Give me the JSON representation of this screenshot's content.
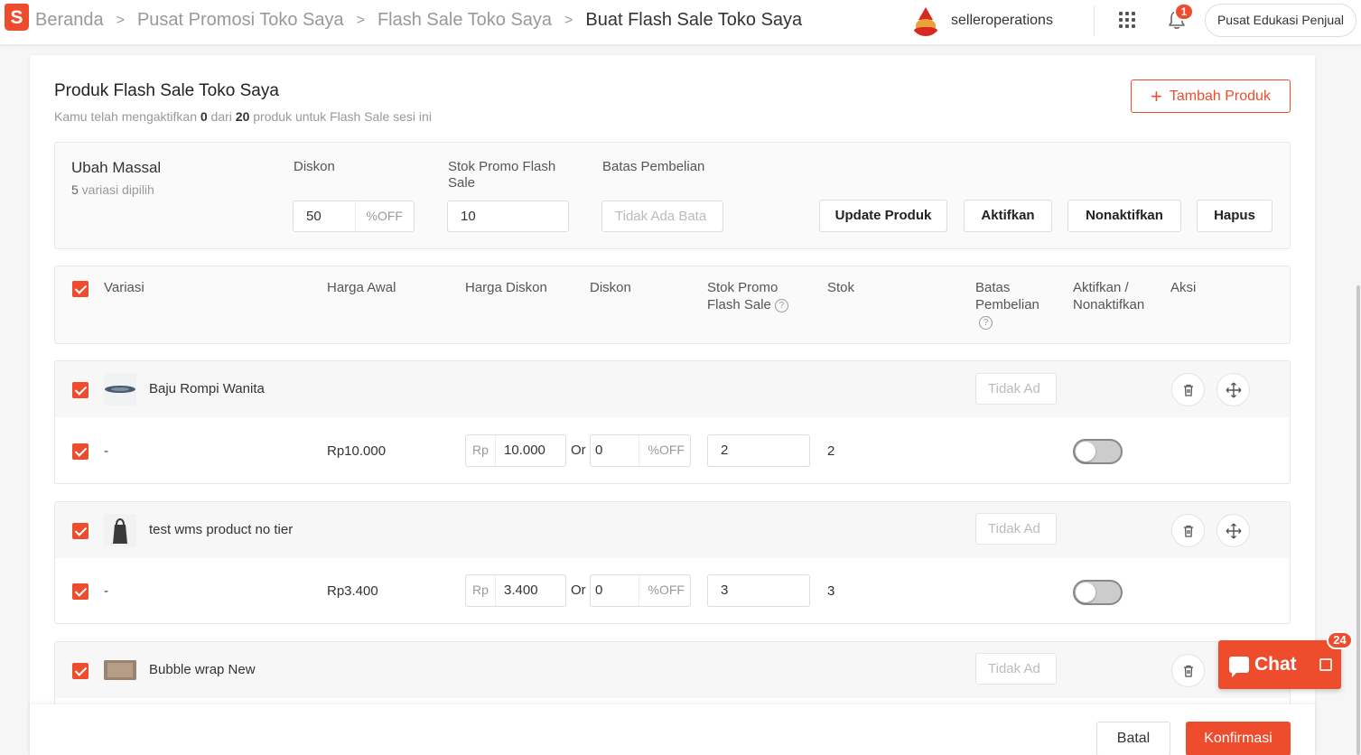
{
  "header": {
    "logo_text": "S",
    "breadcrumbs": [
      "Beranda",
      "Pusat Promosi Toko Saya",
      "Flash Sale Toko Saya",
      "Buat Flash Sale Toko Saya"
    ],
    "username": "selleroperations",
    "notification_count": "1",
    "edu_button": "Pusat Edukasi Penjual"
  },
  "section": {
    "title": "Produk Flash Sale Toko Saya",
    "subtitle_pre": "Kamu telah mengaktifkan ",
    "active_count": "0",
    "subtitle_mid": " dari ",
    "max_count": "20",
    "subtitle_post": " produk untuk Flash Sale sesi ini",
    "add_button": "Tambah Produk"
  },
  "bulk": {
    "title": "Ubah Massal",
    "selected_count": "5",
    "selected_label": " variasi dipilih",
    "discount_label": "Diskon",
    "discount_value": "50",
    "discount_suffix": "%OFF",
    "stock_label_1": "Stok Promo Flash",
    "stock_label_2": "Sale",
    "stock_value": "10",
    "limit_label": "Batas Pembelian",
    "limit_placeholder": "Tidak Ada Bata",
    "buttons": {
      "update": "Update Produk",
      "activate": "Aktifkan",
      "deactivate": "Nonaktifkan",
      "delete": "Hapus"
    }
  },
  "table": {
    "headers": {
      "variation": "Variasi",
      "original_price": "Harga Awal",
      "discount_price": "Harga Diskon",
      "discount": "Diskon",
      "promo_stock_1": "Stok Promo",
      "promo_stock_2": "Flash Sale",
      "stock": "Stok",
      "limit_1": "Batas",
      "limit_2": "Pembelian",
      "toggle_1": "Aktifkan /",
      "toggle_2": "Nonaktifkan",
      "action": "Aksi"
    },
    "limit_placeholder": "Tidak Ad",
    "currency": "Rp",
    "or_label": "Or",
    "off_suffix": "%OFF",
    "products": [
      {
        "name": "Baju Rompi Wanita",
        "variation": "-",
        "original_price": "Rp10.000",
        "discount_price": "10.000",
        "discount_percent": "0",
        "promo_stock": "2",
        "stock": "2"
      },
      {
        "name": "test wms product no tier",
        "variation": "-",
        "original_price": "Rp3.400",
        "discount_price": "3.400",
        "discount_percent": "0",
        "promo_stock": "3",
        "stock": "3"
      },
      {
        "name": "Bubble wrap New"
      }
    ]
  },
  "footer": {
    "cancel": "Batal",
    "confirm": "Konfirmasi"
  },
  "chat": {
    "label": "Chat",
    "badge": "24"
  },
  "colors": {
    "brand": "#ee4d2d",
    "text": "#333333",
    "muted": "#999999"
  }
}
